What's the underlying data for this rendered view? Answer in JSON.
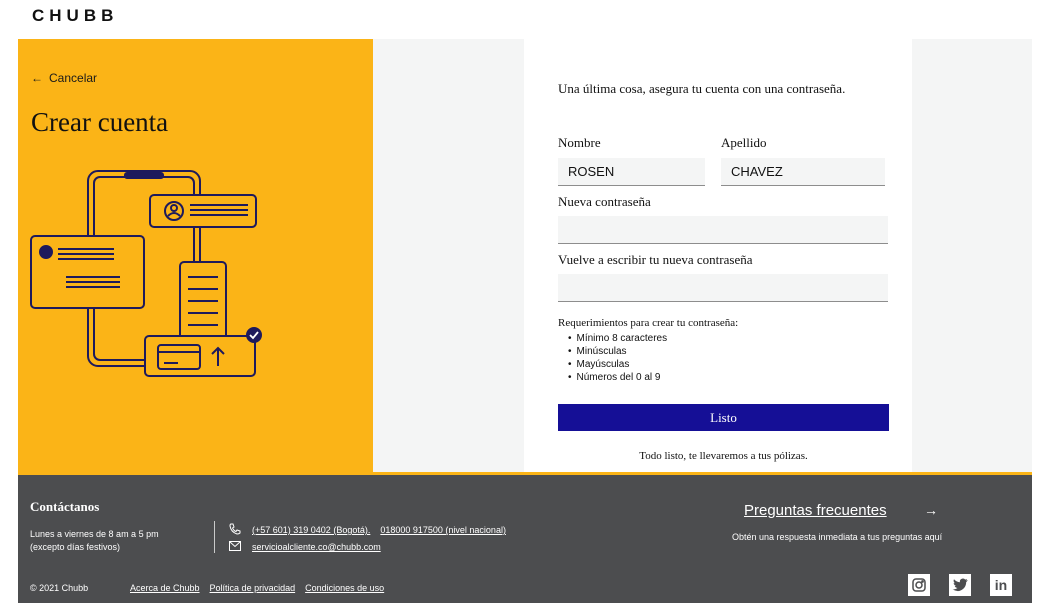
{
  "brand": {
    "logo": "CHUBB"
  },
  "left_panel": {
    "cancel_arrow": "←",
    "cancel_label": "Cancelar",
    "title": "Crear cuenta",
    "colors": {
      "background": "#fbb417",
      "line": "#1e1a5c"
    }
  },
  "form": {
    "intro": "Una última cosa, asegura tu cuenta con una contraseña.",
    "first_name_label": "Nombre",
    "first_name_value": "ROSEN",
    "last_name_label": "Apellido",
    "last_name_value": "CHAVEZ",
    "new_password_label": "Nueva contraseña",
    "new_password_value": "",
    "confirm_password_label": "Vuelve a escribir tu nueva contraseña",
    "confirm_password_value": "",
    "requirements_title": "Requerimientos para crear tu contraseña:",
    "requirements": [
      "Mínimo 8 caracteres",
      "Minúsculas",
      "Mayúsculas",
      "Números del 0 al 9"
    ],
    "submit_label": "Listo",
    "done_message": "Todo listo, te llevaremos a tus pólizas.",
    "colors": {
      "button": "#150f96"
    }
  },
  "footer": {
    "contact_title": "Contáctanos",
    "hours_line1": "Lunes a viernes de 8 am a 5 pm",
    "hours_line2": "(excepto días festivos)",
    "phone_icon": "phone-icon",
    "phone_bogota": "(+57 601) 319 0402 (Bogotá).",
    "phone_national": "018000 917500 (nivel nacional)",
    "mail_icon": "mail-icon",
    "email": "servicioalcliente.co@chubb.com",
    "faq_label": "Preguntas frecuentes",
    "faq_arrow": "→",
    "faq_subtitle": "Obtén una respuesta inmediata a tus preguntas aquí",
    "copyright": "© 2021 Chubb",
    "links": [
      "Acerca de Chubb",
      "Política de privacidad",
      "Condiciones de uso"
    ],
    "social": [
      {
        "icon": "instagram-icon",
        "glyph": "◎"
      },
      {
        "icon": "twitter-icon",
        "glyph": "🐦"
      },
      {
        "icon": "linkedin-icon",
        "glyph": "in"
      }
    ],
    "colors": {
      "background": "#4c4d4f",
      "accent": "#fbb417"
    }
  }
}
